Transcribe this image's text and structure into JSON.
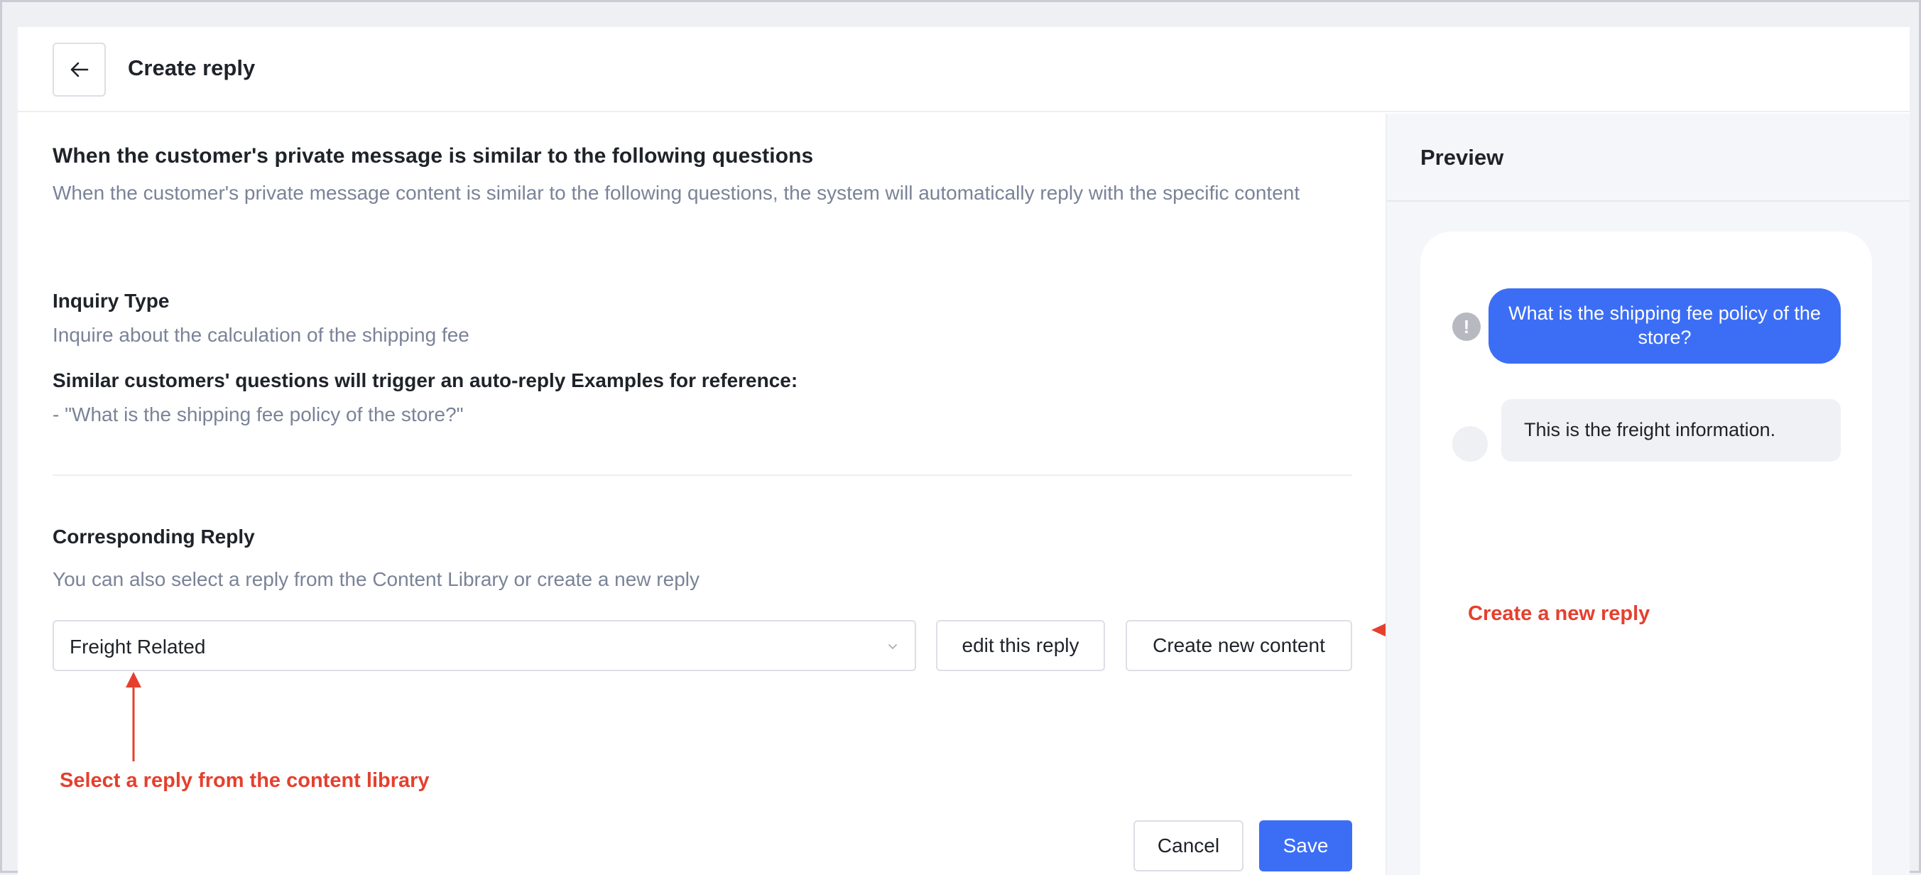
{
  "header": {
    "title": "Create reply"
  },
  "main": {
    "heading": "When the customer's private message is similar to the following questions",
    "description": "When the customer's private message content is similar to the following questions, the system will automatically reply with the specific content",
    "inquiry_label": "Inquiry Type",
    "inquiry_value": "Inquire about the calculation of the shipping fee",
    "examples_label": "Similar customers' questions will trigger an auto-reply Examples for reference:",
    "example_item": "- \"What is the shipping fee policy of the store?\"",
    "reply_label": "Corresponding Reply",
    "reply_hint": "You can also select a reply from the Content Library or create a new reply",
    "select_value": "Freight Related",
    "edit_button": "edit this reply",
    "create_button": "Create new content",
    "cancel_button": "Cancel",
    "save_button": "Save"
  },
  "annotations": {
    "create_new": "Create a new reply",
    "select_library": "Select a reply from the content library"
  },
  "preview": {
    "title": "Preview",
    "customer_message": "What is the shipping fee policy of the store?",
    "reply_message": "This is the freight information.",
    "warning_glyph": "!"
  },
  "colors": {
    "primary": "#3c6ef5",
    "annotation": "#e5402e",
    "muted_text": "#7a8397"
  }
}
